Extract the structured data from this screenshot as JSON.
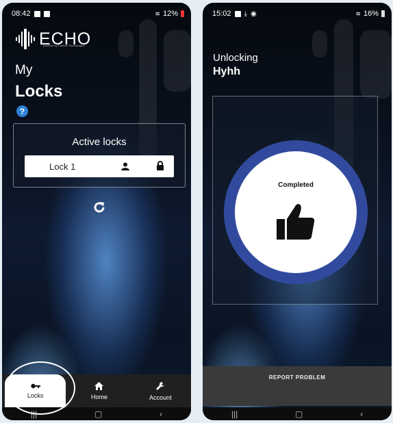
{
  "left": {
    "status": {
      "time": "08:42",
      "battery": "12%"
    },
    "logo": {
      "name": "ECHO",
      "subtitle": "powered by Carbure Technologies"
    },
    "title_small": "My",
    "title_big": "Locks",
    "help_icon": "?",
    "active_locks": {
      "heading": "Active locks",
      "items": [
        {
          "name": "Lock 1",
          "owner_icon": "person-icon",
          "state_icon": "lock-icon"
        }
      ]
    },
    "refresh_icon": "refresh-icon",
    "nav": [
      {
        "label": "Locks",
        "icon": "key-icon",
        "active": true
      },
      {
        "label": "Home",
        "icon": "home-icon",
        "active": false
      },
      {
        "label": "Account",
        "icon": "wrench-icon",
        "active": false
      }
    ],
    "system_nav": [
      "|||",
      "▢",
      "‹"
    ]
  },
  "right": {
    "status": {
      "time": "15:02",
      "battery": "16%"
    },
    "title_small": "Unlocking",
    "title_big": "Hyhh",
    "status_label": "Completed",
    "status_icon": "thumbs-up-icon",
    "report_button": "REPORT PROBLEM",
    "system_nav": [
      "|||",
      "▢",
      "‹"
    ]
  },
  "colors": {
    "ring": "#324a9e",
    "help": "#2d82d6",
    "nav": "#202020",
    "report_bar": "#3a3a3a"
  }
}
